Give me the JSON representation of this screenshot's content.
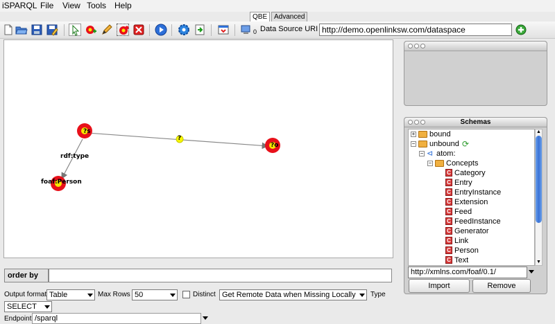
{
  "app": {
    "title": "iSPARQL"
  },
  "menu": {
    "items": [
      "File",
      "View",
      "Tools",
      "Help"
    ]
  },
  "tabs": {
    "qbe": "QBE",
    "advanced": "Advanced",
    "active": "QBE"
  },
  "toolbar": {
    "datasource_counter": "0",
    "datasource_label": "Data Source URI",
    "datasource_value": "http://demo.openlinksw.com/dataspace"
  },
  "graph": {
    "predicate_label": "rdf:type",
    "class_label": "foaf:Person",
    "subject_label": "?s",
    "edge_label": "?",
    "object_label": "?o"
  },
  "order_by": {
    "label": "order by",
    "value": ""
  },
  "options": {
    "output_format_label": "Output format",
    "output_format_value": "Table",
    "max_rows_label": "Max Rows",
    "max_rows_value": "50",
    "distinct_label": "Distinct",
    "remote_data_value": "Get Remote Data when Missing Locally",
    "type_label": "Type",
    "type_value": "SELECT",
    "endpoint_label": "Endpoint",
    "endpoint_value": "/sparql"
  },
  "schemas": {
    "title": "Schemas",
    "tree": {
      "bound": "bound",
      "unbound": "unbound",
      "atom": "atom:",
      "concepts": "Concepts",
      "classes": [
        "Category",
        "Entry",
        "EntryInstance",
        "Extension",
        "Feed",
        "FeedInstance",
        "Generator",
        "Link",
        "Person",
        "Text"
      ]
    },
    "uri_value": "http://xmlns.com/foaf/0.1/",
    "import_label": "Import",
    "remove_label": "Remove"
  },
  "colors": {
    "node_fill": "#e8101a",
    "node_center": "#f7e600",
    "accent_blue": "#3a72d6"
  }
}
